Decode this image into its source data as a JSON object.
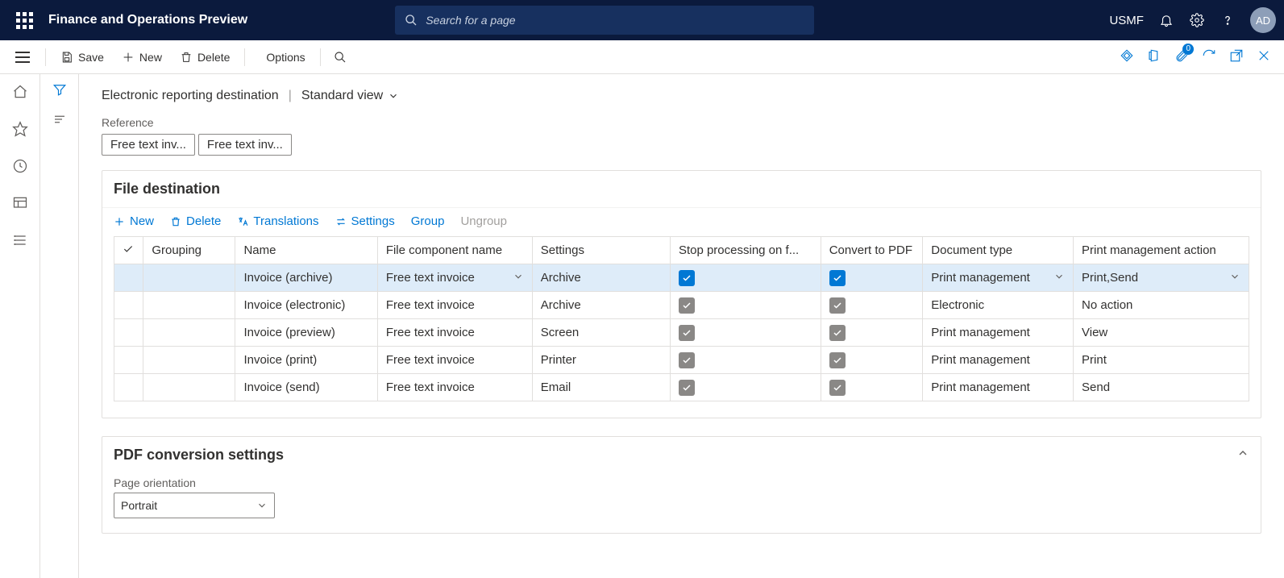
{
  "top": {
    "app_title": "Finance and Operations Preview",
    "search_placeholder": "Search for a page",
    "entity": "USMF",
    "avatar_initials": "AD"
  },
  "actionbar": {
    "save": "Save",
    "new": "New",
    "delete": "Delete",
    "options": "Options",
    "attach_count": "0"
  },
  "crumbs": {
    "page": "Electronic reporting destination",
    "view": "Standard view"
  },
  "reference": {
    "label": "Reference",
    "pill1": "Free text inv...",
    "pill2": "Free text inv..."
  },
  "fileDest": {
    "title": "File destination",
    "toolbar": {
      "new": "New",
      "delete": "Delete",
      "translations": "Translations",
      "settings": "Settings",
      "group": "Group",
      "ungroup": "Ungroup"
    },
    "columns": {
      "grouping": "Grouping",
      "name": "Name",
      "file": "File component name",
      "settings": "Settings",
      "stop": "Stop processing on f...",
      "convert": "Convert to PDF",
      "doctype": "Document type",
      "printact": "Print management action"
    },
    "rows": [
      {
        "name": "Invoice (archive)",
        "file": "Free text invoice",
        "settings": "Archive",
        "stop": true,
        "convert": true,
        "doctype": "Print management",
        "printact": "Print,Send",
        "selected": true
      },
      {
        "name": "Invoice (electronic)",
        "file": "Free text invoice",
        "settings": "Archive",
        "stop": true,
        "convert": true,
        "doctype": "Electronic",
        "printact": "No action",
        "selected": false
      },
      {
        "name": "Invoice (preview)",
        "file": "Free text invoice",
        "settings": "Screen",
        "stop": true,
        "convert": true,
        "doctype": "Print management",
        "printact": "View",
        "selected": false
      },
      {
        "name": "Invoice (print)",
        "file": "Free text invoice",
        "settings": "Printer",
        "stop": true,
        "convert": true,
        "doctype": "Print management",
        "printact": "Print",
        "selected": false
      },
      {
        "name": "Invoice (send)",
        "file": "Free text invoice",
        "settings": "Email",
        "stop": true,
        "convert": true,
        "doctype": "Print management",
        "printact": "Send",
        "selected": false
      }
    ]
  },
  "pdf": {
    "title": "PDF conversion settings",
    "orientation_label": "Page orientation",
    "orientation_value": "Portrait"
  }
}
